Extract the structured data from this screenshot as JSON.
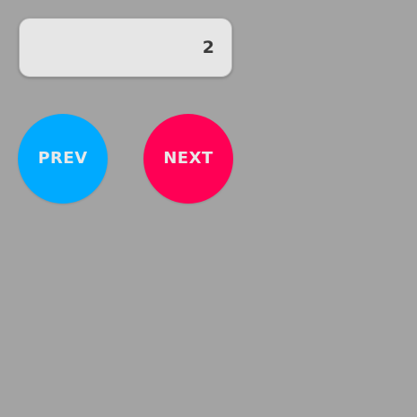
{
  "display": {
    "value": "2"
  },
  "buttons": {
    "prev": {
      "label": "PREV",
      "color": "#00aaff"
    },
    "next": {
      "label": "NEXT",
      "color": "#ff0055"
    }
  },
  "colors": {
    "background": "#a3a3a3",
    "display_background": "#e6e6e6",
    "display_text": "#3a3a3a",
    "button_text": "#e8e8e8"
  }
}
